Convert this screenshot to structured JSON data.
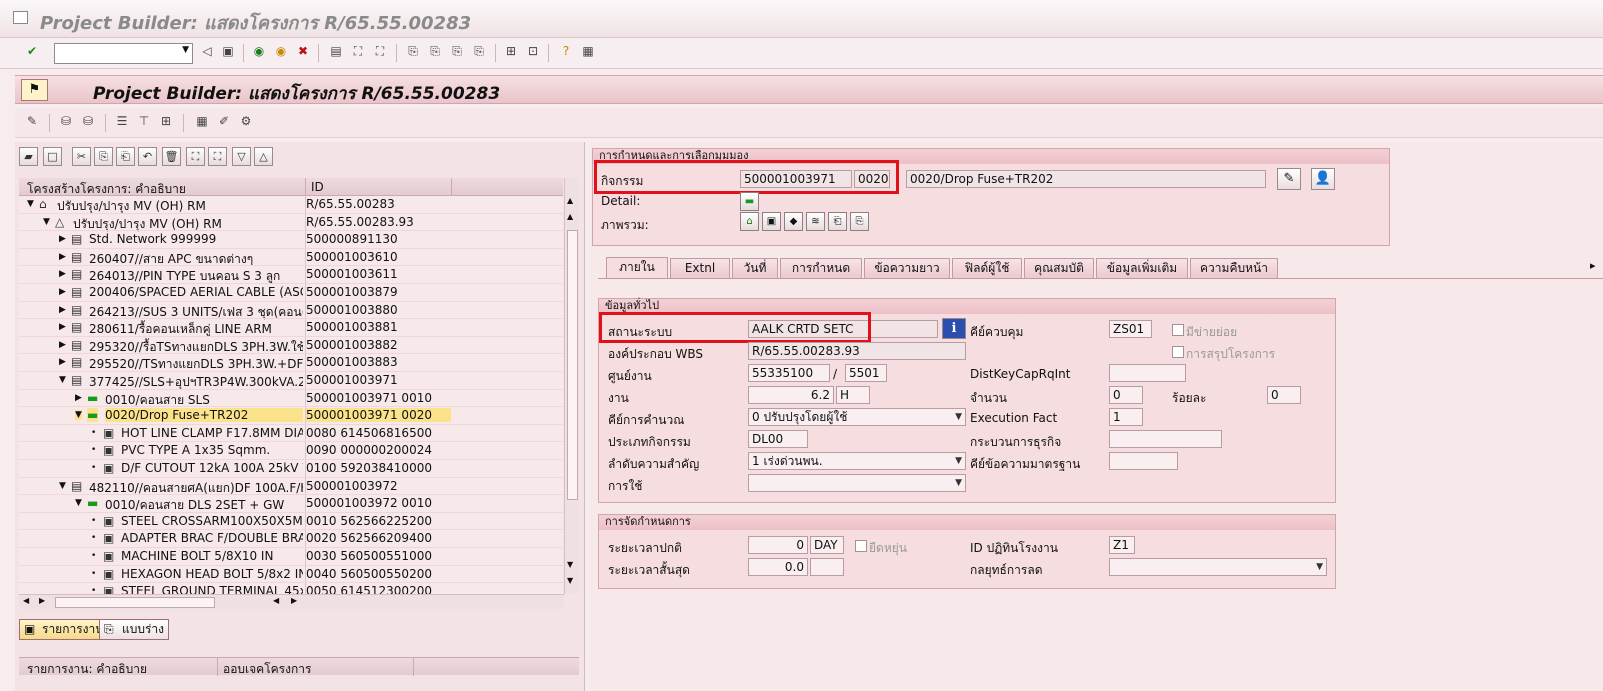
{
  "window": {
    "title": "Project Builder: แสดงโครงการ R/65.55.00283"
  },
  "header": {
    "title": "Project Builder: แสดงโครงการ R/65.55.00283"
  },
  "tree": {
    "col_desc": "โครงสร้างโครงการ: คำอธิบาย",
    "col_id": "ID",
    "rows": [
      {
        "d": "ปรับปรุง/ปารุง MV (OH) RM",
        "id": "R/65.55.00283",
        "lvl": 0,
        "exp": "▼",
        "icon": "⌂"
      },
      {
        "d": "ปรับปรุง/ปารุง MV (OH) RM",
        "id": "R/65.55.00283.93",
        "lvl": 1,
        "exp": "▼",
        "icon": "△"
      },
      {
        "d": "Std. Network 999999",
        "id": "500000891130",
        "lvl": 2,
        "exp": "▶",
        "icon": "▤"
      },
      {
        "d": "260407//สาย APC ขนาดต่างๆ",
        "id": "500001003610",
        "lvl": 2,
        "exp": "▶",
        "icon": "▤"
      },
      {
        "d": "264013//PIN TYPE บนคอน S 3 ลูก",
        "id": "500001003611",
        "lvl": 2,
        "exp": "▶",
        "icon": "▤"
      },
      {
        "d": "200406/SPACED AERIAL CABLE (ASC)",
        "id": "500001003879",
        "lvl": 2,
        "exp": "▶",
        "icon": "▤"
      },
      {
        "d": "264213//SUS 3 UNITS/เฟส 3 ชุด(คอนคู่)",
        "id": "500001003880",
        "lvl": 2,
        "exp": "▶",
        "icon": "▤"
      },
      {
        "d": "280611/รื้อคอนเหล็กคู่ LINE ARM",
        "id": "500001003881",
        "lvl": 2,
        "exp": "▶",
        "icon": "▤"
      },
      {
        "d": "295320//รื้อTSทางแยกDLS 3PH.3W.ใช้TS",
        "id": "500001003882",
        "lvl": 2,
        "exp": "▶",
        "icon": "▤"
      },
      {
        "d": "295520//TSทางแยกDLS 3PH.3W.+DF",
        "id": "500001003883",
        "lvl": 2,
        "exp": "▶",
        "icon": "▤"
      },
      {
        "d": "377425//SLS+อุปฯTR3P4W.300kVA.24kV",
        "id": "500001003971",
        "lvl": 2,
        "exp": "▼",
        "icon": "▤"
      },
      {
        "d": "0010/คอนสาย SLS",
        "id": "500001003971 0010",
        "lvl": 3,
        "exp": "▶",
        "icon": "▬"
      },
      {
        "d": "0020/Drop Fuse+TR202",
        "id": "500001003971 0020",
        "lvl": 3,
        "exp": "▼",
        "icon": "▬",
        "sel": true
      },
      {
        "d": "HOT LINE CLAMP F17.8MM DIA R",
        "id": "0080 614506816500",
        "lvl": 4,
        "exp": "•",
        "icon": "▣"
      },
      {
        "d": "PVC TYPE A 1x35 Sqmm.",
        "id": "0090 000000200024",
        "lvl": 4,
        "exp": "•",
        "icon": "▣"
      },
      {
        "d": "D/F CUTOUT 12kA 100A 25kV W",
        "id": "0100 592038410000",
        "lvl": 4,
        "exp": "•",
        "icon": "▣"
      },
      {
        "d": "482110//คอนสายศA(แยก)DF 100A.F/HT",
        "id": "500001003972",
        "lvl": 2,
        "exp": "▼",
        "icon": "▤"
      },
      {
        "d": "0010/คอนสาย DLS 2SET + GW",
        "id": "500001003972 0010",
        "lvl": 3,
        "exp": "▼",
        "icon": "▬"
      },
      {
        "d": "STEEL CROSSARM100X50X5MMX2",
        "id": "0010 562566225200",
        "lvl": 4,
        "exp": "•",
        "icon": "▣"
      },
      {
        "d": "ADAPTER BRAC F/DOUBLE BRACE",
        "id": "0020 562566209400",
        "lvl": 4,
        "exp": "•",
        "icon": "▣"
      },
      {
        "d": "MACHINE BOLT 5/8X10 IN",
        "id": "0030 560500551000",
        "lvl": 4,
        "exp": "•",
        "icon": "▣"
      },
      {
        "d": "HEXAGON HEAD BOLT 5/8x2 IN",
        "id": "0040 560500550200",
        "lvl": 4,
        "exp": "•",
        "icon": "▣"
      },
      {
        "d": "STEEL GROUND TERMINAL 45x60",
        "id": "0050 614512300200",
        "lvl": 4,
        "exp": "•",
        "icon": "▣"
      }
    ]
  },
  "bottom_tabs": {
    "worklist": "รายการงาน",
    "template": "แบบร่าง"
  },
  "lower_list": {
    "col_desc": "รายการงาน: คำอธิบาย",
    "col_obj": "ออบเจคโครงการ"
  },
  "ident": {
    "group_title": "การกำหนดและการเลือกมุมมอง",
    "activity_label": "กิจกรรม",
    "network": "500001003971",
    "activity_no": "0020",
    "activity_desc": "0020/Drop Fuse+TR202",
    "detail_label": "Detail:",
    "overview_label": "ภาพรวม:"
  },
  "tabs": [
    "ภายใน",
    "Extnl",
    "วันที่",
    "การกำหนด",
    "ข้อความยาว",
    "ฟิลด์ผู้ใช้",
    "คุณสมบัติ",
    "ข้อมูลเพิ่มเติม",
    "ความคืบหน้า"
  ],
  "general": {
    "group_title": "ข้อมูลทั่วไป",
    "system_status_label": "สถานะระบบ",
    "system_status": "AALK CRTD SETC",
    "control_key_label": "คีย์ควบคุม",
    "control_key": "ZS01",
    "subnet_label": "มีข่ายย่อย",
    "wbs_label": "องค์ประกอบ WBS",
    "wbs": "R/65.55.00283.93",
    "proj_summary_label": "การสรุปโครงการ",
    "work_center_label": "ศูนย์งาน",
    "work_center": "55335100",
    "plant": "5501",
    "distkey_label": "DistKeyCapRqInt",
    "work_label": "งาน",
    "work": "6.2",
    "work_unit": "H",
    "number_label": "จำนวน",
    "number": "0",
    "percent_label": "ร้อยละ",
    "percent": "0",
    "calc_key_label": "คีย์การคำนวณ",
    "calc_key": "0 ปรับปรุงโดยผู้ใช้",
    "exec_fact_label": "Execution Fact",
    "exec_fact": "1",
    "activity_type_label": "ประเภทกิจกรรม",
    "activity_type": "DL00",
    "biz_process_label": "กระบวนการธุรกิจ",
    "priority_label": "ลำดับความสำคัญ",
    "priority": "1 เร่งด่วนพน.",
    "std_text_key_label": "คีย์ข้อความมาตรฐาน",
    "usage_label": "การใช้"
  },
  "scheduling": {
    "group_title": "การจัดกำหนดการ",
    "normal_dur_label": "ระยะเวลาปกติ",
    "normal_dur": "0",
    "normal_dur_unit": "DAY",
    "flexible_label": "ยืดหยุ่น",
    "factory_cal_label": "ID ปฏิทินโรงงาน",
    "factory_cal": "Z1",
    "min_dur_label": "ระยะเวลาสั้นสุด",
    "min_dur": "0.0",
    "reduction_label": "กลยุทธ์การลด"
  },
  "colors": {
    "highlight": "#e0111b",
    "selection": "#fbe38b"
  }
}
